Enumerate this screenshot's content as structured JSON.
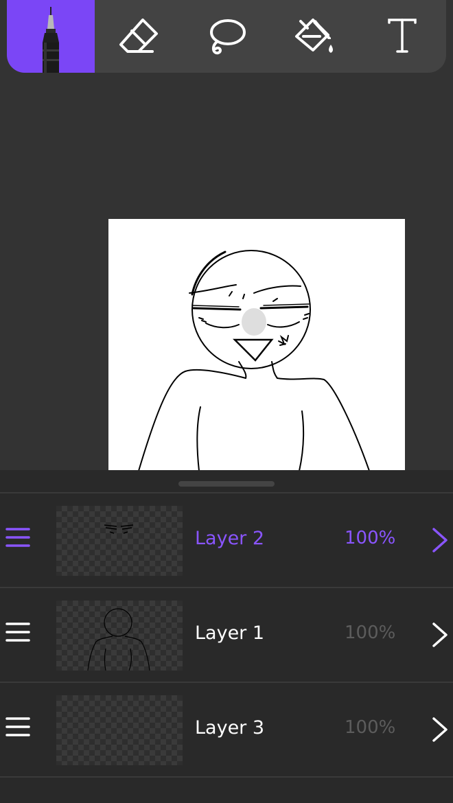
{
  "toolbar": {
    "accent": "#7b46f6",
    "tools": [
      {
        "name": "brush",
        "icon": "pen-brush-icon",
        "active": true
      },
      {
        "name": "eraser",
        "icon": "eraser-icon",
        "active": false
      },
      {
        "name": "lasso",
        "icon": "lasso-icon",
        "active": false
      },
      {
        "name": "fill",
        "icon": "paint-bucket-icon",
        "active": false
      },
      {
        "name": "text",
        "icon": "text-icon",
        "active": false
      }
    ]
  },
  "layers": [
    {
      "name": "Layer 2",
      "opacity": "100%",
      "active": true
    },
    {
      "name": "Layer 1",
      "opacity": "100%",
      "active": false
    },
    {
      "name": "Layer 3",
      "opacity": "100%",
      "active": false
    }
  ],
  "colors": {
    "active_layer": "#8a55ff",
    "inactive_opacity": "#5c5c5c"
  }
}
